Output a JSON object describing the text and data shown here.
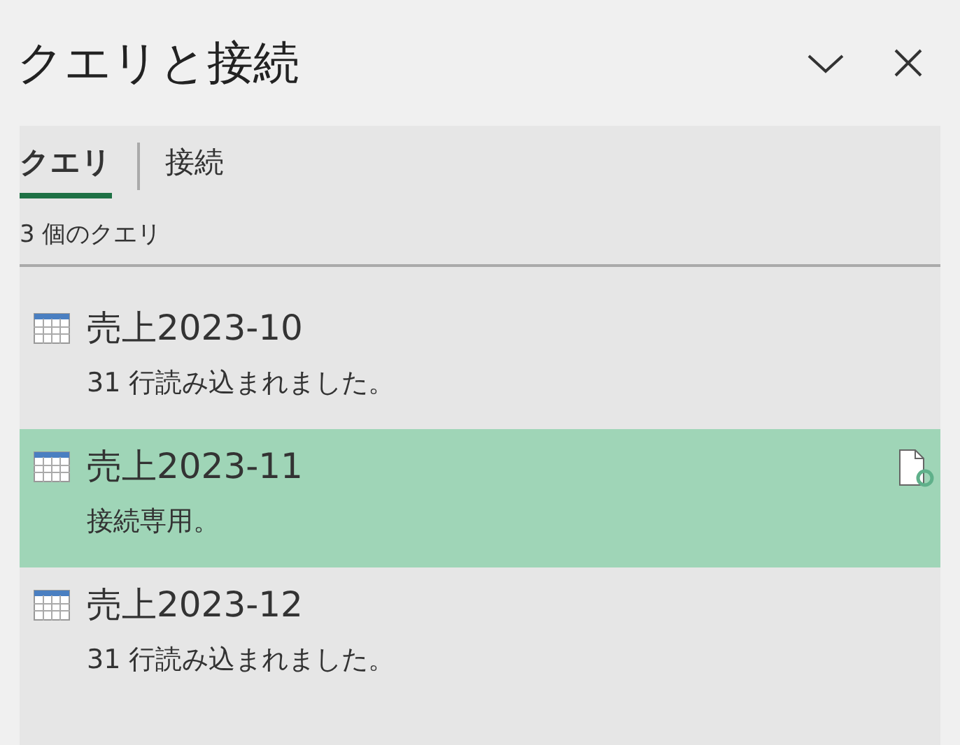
{
  "title": "クエリと接続",
  "tabs": [
    {
      "label": "クエリ",
      "selected": true
    },
    {
      "label": "接続",
      "selected": false
    }
  ],
  "count": "3 個のクエリ",
  "queries": [
    {
      "name": "売上2023-10",
      "status": "31 行読み込まれました。",
      "selected": false,
      "connection_only": false
    },
    {
      "name": "売上2023-11",
      "status": "接続専用。",
      "selected": true,
      "connection_only": true
    },
    {
      "name": "売上2023-12",
      "status": "31 行読み込まれました。",
      "selected": false,
      "connection_only": false
    }
  ]
}
